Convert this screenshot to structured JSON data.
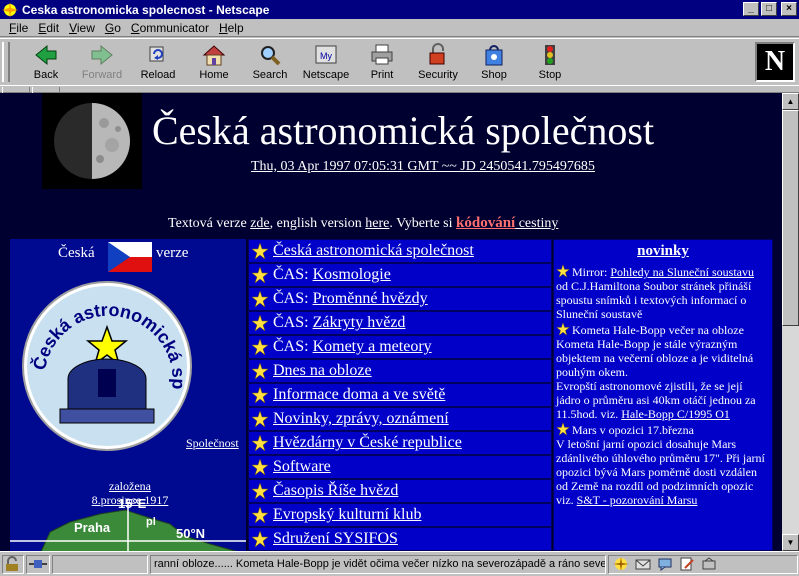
{
  "window": {
    "title": "Ceska astronomicka spolecnost - Netscape",
    "minimize": "_",
    "maximize": "□",
    "close": "×"
  },
  "menubar": {
    "items": [
      {
        "label": "File",
        "underline": "F",
        "rest": "ile"
      },
      {
        "label": "Edit",
        "underline": "E",
        "rest": "dit"
      },
      {
        "label": "View",
        "underline": "V",
        "rest": "iew"
      },
      {
        "label": "Go",
        "underline": "G",
        "rest": "o"
      },
      {
        "label": "Communicator",
        "underline": "C",
        "rest": "ommunicator"
      },
      {
        "label": "Help",
        "underline": "H",
        "rest": "elp"
      }
    ]
  },
  "toolbar": {
    "back": "Back",
    "forward": "Forward",
    "reload": "Reload",
    "home": "Home",
    "search": "Search",
    "netscape": "Netscape",
    "print": "Print",
    "security": "Security",
    "shop": "Shop",
    "stop": "Stop",
    "logo": "N"
  },
  "header": {
    "title": "Česká astronomická společnost",
    "datetime": "Thu, 03 Apr 1997 07:05:31 GMT ~~ JD 2450541.795497685",
    "text_prefix": "Textová verze ",
    "text_link": "zde",
    "english_prefix": ", english version ",
    "english_link": "here",
    "choose": ". Vyberte si ",
    "kodovani": "kódování",
    "cestiny": " cestiny"
  },
  "leftcol": {
    "ceska": "Česká",
    "verze": "verze",
    "logo_text": "Česká astronomická společnost",
    "zalozena": "založena",
    "date": "8.prosince 1917",
    "spolecnost": "Společnost",
    "map_15e": "15°E",
    "map_praha": "Praha",
    "map_50n": "50°N",
    "map_pl": "pl"
  },
  "menu": {
    "items": [
      {
        "prefix": "",
        "link": "Česká astronomická společnost"
      },
      {
        "prefix": "ČAS: ",
        "link": "Kosmologie"
      },
      {
        "prefix": "ČAS: ",
        "link": "Proměnné hvězdy"
      },
      {
        "prefix": "ČAS: ",
        "link": "Zákryty hvězd"
      },
      {
        "prefix": "ČAS: ",
        "link": "Komety a meteory"
      },
      {
        "prefix": "",
        "link": "Dnes na obloze"
      },
      {
        "prefix": "",
        "link": "Informace doma a ve světě"
      },
      {
        "prefix": "",
        "link": "Novinky, zprávy, oznámení"
      },
      {
        "prefix": "",
        "link": "Hvězdárny v České republice"
      },
      {
        "prefix": "",
        "link": "Software"
      },
      {
        "prefix": "",
        "link": "Časopis Říše hvězd"
      },
      {
        "prefix": "",
        "link": "Evropský kulturní klub"
      },
      {
        "prefix": "",
        "link": "Sdružení SYSIFOS"
      }
    ]
  },
  "news": {
    "heading": "novinky",
    "item1_prefix": "Mirror: ",
    "item1_link": "Pohledy na Sluneční soustavu",
    "item1_rest": " od C.J.Hamiltona Soubor stránek přináší spoustu snímků i textových informací o Sluneční soustavě",
    "item2_head": "Kometa Hale-Bopp večer na obloze",
    "item2_body": "Kometa Hale-Bopp je stále výrazným objektem na večerní obloze a je viditelná pouhým okem.",
    "item2_body2": "Evropští astronomové zjistili, že se její jádro o průměru asi 40km otáčí jednou za 11.5hod. viz. ",
    "item2_link": "Hale-Bopp C/1995 O1",
    "item3_head": "Mars v opozici 17.března",
    "item3_body": "V letošní jarní opozici dosahuje Mars zdánlivého úhlového průměru 17\". Při jarní opozici bývá Mars poměrně dosti vzdálen od Země na rozdíl od podzimních opozic",
    "item3_viz": "viz. ",
    "item3_link": "S&T - pozorování Marsu"
  },
  "status": {
    "text": "ranní obloze...... Kometa Hale-Bopp je vidět očima večer nízko na severozápadě a ráno severovýchodě"
  }
}
